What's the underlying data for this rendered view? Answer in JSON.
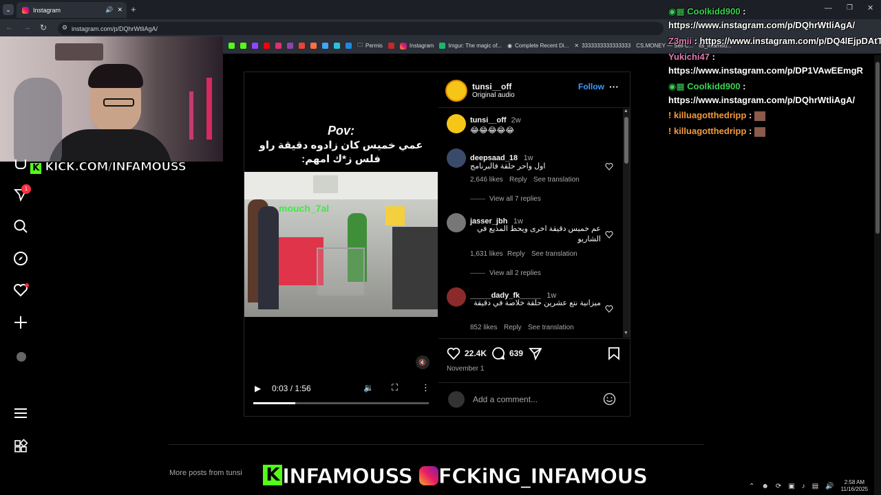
{
  "browser": {
    "tab_title": "Instagram",
    "url": "instagram.com/p/DQhrWtliAgA/",
    "bookmarks": [
      "Permis",
      "Instagram",
      "Imgur: The magic of...",
      "Complete Recent Di...",
      "3333333333333333",
      "CS.MONEY — Sell C...",
      "its_infamou..."
    ]
  },
  "stream_overlay": {
    "kick_url": "KICK.COM/INFAMOUSS",
    "bottom_kick": "INFAMOUSS",
    "bottom_ig": "FCKiNG_INFAMOUS",
    "nav_badge": "1"
  },
  "chat": [
    {
      "user": "Coolkidd900",
      "text": "https://www.instagram.com/p/DQhrWtliAgA/",
      "color": "#39d353"
    },
    {
      "user": "Z3mii",
      "text": "https://www.instagram.com/p/DQ4lEjpDAtT/",
      "color": "#e07ab2"
    },
    {
      "user": "Yukichi47",
      "text": "https://www.instagram.com/p/DP1VAwEEmgR",
      "color": "#e07ab2"
    },
    {
      "user": "Coolkidd900",
      "text": "https://www.instagram.com/p/DQhrWtliAgA/",
      "color": "#39d353"
    },
    {
      "user": "killuagotthedripp",
      "text": "",
      "color": "#f29a3a"
    },
    {
      "user": "killuagotthedripp",
      "text": "",
      "color": "#f29a3a"
    }
  ],
  "post": {
    "author": "tunsi__off",
    "audio": "Original audio",
    "follow_label": "Follow",
    "video_title": "Pov:",
    "video_caption_line1": "عمي خميس كان زادوه دقيقة راو",
    "video_caption_line2": "فلس ز*ك امهم:",
    "video_watermark": "mouch_7al",
    "video_time": "0:03 / 1:56",
    "video_progress": 0.24,
    "caption_user": "tunsi__off",
    "caption_time": "2w",
    "caption_text": "😂😂😂😂😂",
    "comments": [
      {
        "user": "deepsaad_18",
        "time": "1w",
        "text": "اول واحر حلقة فالبرنامج",
        "likes": "2,646 likes",
        "reply": "Reply",
        "translate": "See translation",
        "view_replies": "View all 7 replies"
      },
      {
        "user": "jasser_jbh",
        "time": "1w",
        "text": "عم خميس دقيقة اخرى ويحط المذيع في الشاريو",
        "likes": "1,631 likes",
        "reply": "Reply",
        "translate": "See translation",
        "view_replies": "View all 2 replies"
      },
      {
        "user": "_____dady_fk_____",
        "time": "1w",
        "text": "ميزانية نتع عشرين حلقة خلاصة في دقيقة",
        "likes": "852 likes",
        "reply": "Reply",
        "translate": "See translation",
        "view_replies": ""
      }
    ],
    "like_count": "22.4K",
    "comment_count": "639",
    "date": "November 1",
    "add_comment_placeholder": "Add a comment...",
    "more_posts": "More posts from tunsi"
  },
  "taskbar": {
    "time": "2:58 AM",
    "date": "11/16/2025"
  }
}
